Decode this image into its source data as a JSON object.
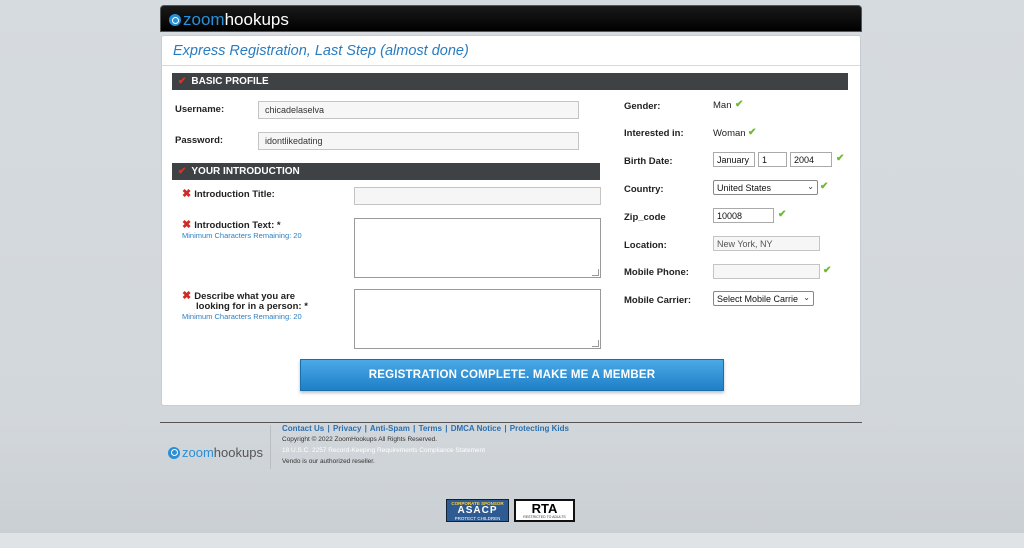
{
  "header": {
    "logo_zoom": "zoom",
    "logo_hookups": "hookups"
  },
  "page": {
    "title": "Express Registration, Last Step (almost done)"
  },
  "basic_profile": {
    "section_title": "BASIC PROFILE",
    "username_label": "Username:",
    "username_value": "chicadelaselva",
    "password_label": "Password:",
    "password_value": "idontlikedating"
  },
  "introduction": {
    "section_title": "YOUR INTRODUCTION",
    "title_label": "Introduction Title:",
    "text_label": "Introduction Text: *",
    "text_hint": "Minimum Characters Remaining: 20",
    "describe_label_1": "Describe what you are",
    "describe_label_2": "looking for in a person: *",
    "describe_hint": "Minimum Characters Remaining: 20"
  },
  "details": {
    "gender_label": "Gender:",
    "gender_value": "Man",
    "interested_label": "Interested in:",
    "interested_value": "Woman",
    "birth_label": "Birth Date:",
    "birth_month": "January",
    "birth_day": "1",
    "birth_year": "2004",
    "country_label": "Country:",
    "country_value": "United States",
    "zip_label": "Zip_code",
    "zip_value": "10008",
    "location_label": "Location:",
    "location_value": "New York, NY",
    "mobile_phone_label": "Mobile Phone:",
    "mobile_phone_value": "",
    "mobile_carrier_label": "Mobile Carrier:",
    "mobile_carrier_value": "Select Mobile Carrie"
  },
  "submit": {
    "label": "REGISTRATION COMPLETE. MAKE ME A MEMBER"
  },
  "footer": {
    "links": [
      "Contact Us",
      "Privacy",
      "Anti-Spam",
      "Terms",
      "DMCA Notice",
      "Protecting Kids"
    ],
    "separator": "|",
    "copyright": "Copyright © 2022 ZoomHookups All Rights Reserved.",
    "compliance": "18 U.S.C. 2257 Record-Keeping Requirements Compliance Statement",
    "reseller": "Vendo is our authorized reseller.",
    "logo_zoom": "zoom",
    "logo_hookups": "hookups"
  },
  "badges": {
    "asacp_top": "CORPORATE SPONSOR",
    "asacp_main": "ASACP",
    "asacp_bottom": "PROTECT CHILDREN",
    "rta_main": "RTA",
    "rta_bottom": "RESTRICTED TO ADULTS"
  },
  "colors": {
    "accent_blue": "#2a7cc0",
    "section_bar": "#3e4245",
    "check_green": "#6dbb2c",
    "x_red": "#cf2a25"
  }
}
